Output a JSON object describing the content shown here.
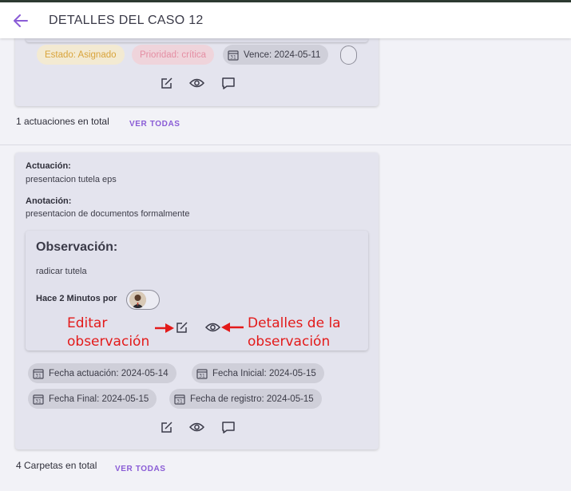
{
  "header": {
    "title": "DETALLES DEL CASO 12"
  },
  "previous_card": {
    "chips": {
      "estado": "Estado: Asignado",
      "prioridad": "Prioridad: crítica",
      "vence": "Vence: 2024-05-11"
    }
  },
  "actuaciones_summary": {
    "count_text": "1 actuaciones en total",
    "link": "VER TODAS"
  },
  "actuacion_card": {
    "actuacion_label": "Actuación:",
    "actuacion_value": "presentacion tutela eps",
    "anotacion_label": "Anotación:",
    "anotacion_value": "presentacion de documentos formalmente",
    "observacion": {
      "title": "Observación:",
      "text": "radicar tutela",
      "by": "Hace 2 Minutos por"
    },
    "chips": {
      "fecha_actuacion": "Fecha actuación: 2024-05-14",
      "fecha_inicial": "Fecha Inicial: 2024-05-15",
      "fecha_final": "Fecha Final: 2024-05-15",
      "fecha_registro": "Fecha de registro: 2024-05-15"
    }
  },
  "carpetas_summary": {
    "count_text": "4 Carpetas en total",
    "link": "VER TODAS"
  },
  "annotations": {
    "editar_line1": "Editar",
    "editar_line2": "observación",
    "detalles_line1": "Detalles de la",
    "detalles_line2": "observación"
  },
  "colors": {
    "accent": "#8a5cd6",
    "annotation": "#e31a1a",
    "card_bg": "#e4e4ee"
  },
  "icons": [
    "arrow-left-icon",
    "edit-icon",
    "eye-icon",
    "comment-icon",
    "calendar-icon"
  ]
}
